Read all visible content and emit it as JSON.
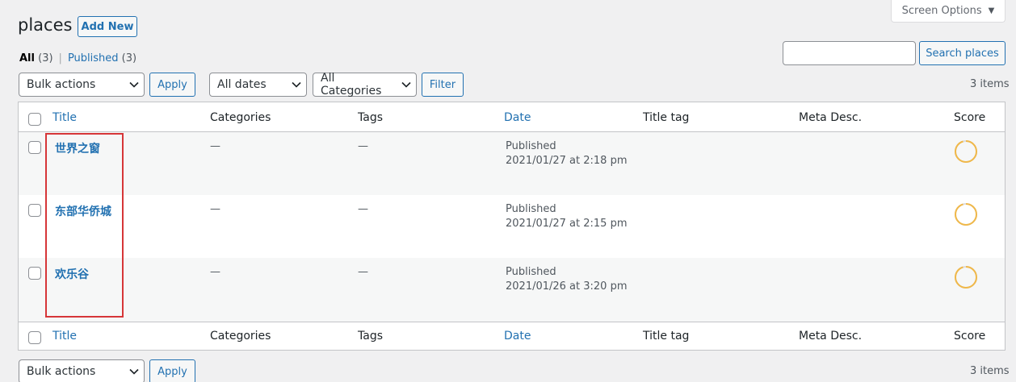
{
  "screen_options": {
    "label": "Screen Options",
    "caret": "▼"
  },
  "header": {
    "title": "places",
    "add_new": "Add New"
  },
  "views": {
    "all_label": "All",
    "all_count": "(3)",
    "separator": "|",
    "published_label": "Published",
    "published_count": "(3)"
  },
  "search": {
    "button": "Search places",
    "value": ""
  },
  "toolbar_top": {
    "bulk_actions": "Bulk actions",
    "apply": "Apply",
    "dates": "All dates",
    "categories": "All Categories",
    "filter": "Filter",
    "items_count": "3 items"
  },
  "toolbar_bottom": {
    "bulk_actions": "Bulk actions",
    "apply": "Apply",
    "items_count": "3 items"
  },
  "columns": {
    "title": "Title",
    "categories": "Categories",
    "tags": "Tags",
    "date": "Date",
    "title_tag": "Title tag",
    "meta_desc": "Meta Desc.",
    "score": "Score"
  },
  "rows": [
    {
      "title": "世界之窗",
      "categories": "—",
      "tags": "—",
      "status": "Published",
      "date": "2021/01/27 at 2:18 pm",
      "score": 0.95
    },
    {
      "title": "东部华侨城",
      "categories": "—",
      "tags": "—",
      "status": "Published",
      "date": "2021/01/27 at 2:15 pm",
      "score": 0.95
    },
    {
      "title": "欢乐谷",
      "categories": "—",
      "tags": "—",
      "status": "Published",
      "date": "2021/01/26 at 3:20 pm",
      "score": 0.95
    }
  ],
  "colors": {
    "link": "#2271b1",
    "score_ring": "#f0b849",
    "highlight_box": "#d63638"
  },
  "icons": {
    "dropdown": "chevron-down-icon",
    "score": "seo-score-ring-icon"
  }
}
